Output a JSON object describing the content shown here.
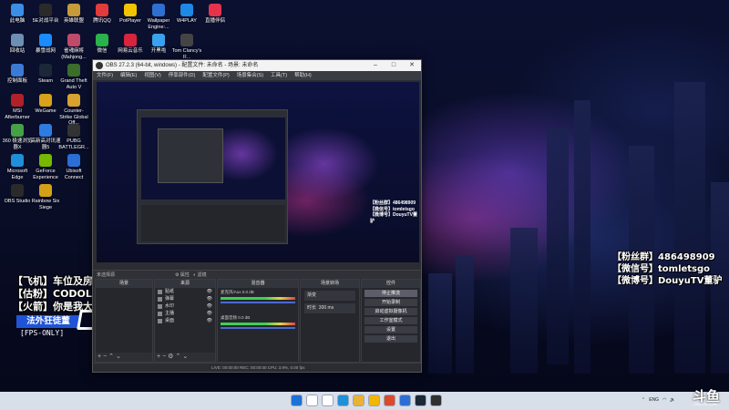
{
  "desktop": {
    "icons": [
      {
        "label": "此电脑",
        "color": "#3a8ee6"
      },
      {
        "label": "5E对战平台",
        "color": "#2a2a2a"
      },
      {
        "label": "英雄联盟",
        "color": "#c79a3a"
      },
      {
        "label": "腾讯QQ",
        "color": "#e23b3b"
      },
      {
        "label": "PotPlayer",
        "color": "#f2c400"
      },
      {
        "label": "Wallpaper Engine:...",
        "color": "#2f6fd0"
      },
      {
        "label": "W4PLAY",
        "color": "#1e88e5"
      },
      {
        "label": "直播伴侣",
        "color": "#e5334d"
      },
      {
        "label": "回收站",
        "color": "#6d8fb3"
      },
      {
        "label": "暴雪战网",
        "color": "#1a8cff"
      },
      {
        "label": "雀魂麻将 (Mahjong...",
        "color": "#c04a6a"
      },
      {
        "label": "微信",
        "color": "#2ab34a"
      },
      {
        "label": "网易云音乐",
        "color": "#d8243d"
      },
      {
        "label": "开黑啦",
        "color": "#3aa0f0"
      },
      {
        "label": "Tom Clancy's R...",
        "color": "#444444"
      },
      {
        "label": "控制面板",
        "color": "#3b7bd6"
      },
      {
        "label": "Steam",
        "color": "#1b2838"
      },
      {
        "label": "Grand Theft Auto V",
        "color": "#3a6e2a"
      },
      {
        "label": "MSI Afterburner",
        "color": "#b2202a"
      },
      {
        "label": "WeGame",
        "color": "#d9a21b"
      },
      {
        "label": "Counter-Strike Global Off...",
        "color": "#d8a230"
      },
      {
        "label": "360 极速浏览器X",
        "color": "#46a046"
      },
      {
        "label": "高新高对讯速 器5",
        "color": "#2f7ce0"
      },
      {
        "label": "PUBG BATTLEGR...",
        "color": "#333333"
      },
      {
        "label": "Microsoft Edge",
        "color": "#1f8fd9"
      },
      {
        "label": "GeForce Experience",
        "color": "#76b900"
      },
      {
        "label": "Ubisoft Connect",
        "color": "#2b6fd6"
      },
      {
        "label": "OBS Studio",
        "color": "#2a2a2a"
      },
      {
        "label": "Rainbow Six Siege",
        "color": "#d4a017"
      }
    ]
  },
  "overlay_left": {
    "line1": "【飞机】车位及房管",
    "line2": "【估粉】CODOL输狗",
    "line3": "【火箭】你是我大哥",
    "badge": "法外狂徒董",
    "fps": "[FPS-ONLY]"
  },
  "overlay_right": {
    "line1": "【粉丝群】486498909",
    "line2": "【微信号】tomletsgo",
    "line3": "【微博号】DouyuTV董驴"
  },
  "obs": {
    "title": "OBS 27.2.3 (64-bit, windows) - 配置文件: 未命名 - 场景: 未命名",
    "menu": [
      "文件(F)",
      "编辑(E)",
      "视图(V)",
      "停靠部件(D)",
      "配置文件(P)",
      "场景集合(S)",
      "工具(T)",
      "帮助(H)"
    ],
    "preview_text": [
      "【粉丝群】486498909",
      "【微信号】tomletsgo",
      "【微博号】DouyuTV董驴"
    ],
    "source_bar_label": "未选择源",
    "source_bar_props": "属性",
    "source_bar_filter": "滤镜",
    "docks": {
      "scenes": "场景",
      "sources": "来源",
      "mixer": "混音器",
      "transitions": "场景转场",
      "controls": "控件"
    },
    "sources": [
      "贴纸",
      "弹幕",
      "水印",
      "主播",
      "桌面"
    ],
    "mixer_tracks": [
      {
        "name": "麦克风/Aux",
        "level": "0.0 dB"
      },
      {
        "name": "桌面音频",
        "level": "0.0 dB"
      }
    ],
    "transition": "渐变",
    "duration_label": "时长",
    "duration_value": "300 ms",
    "controls": [
      "停止推流",
      "开始录制",
      "启动虚拟摄像机",
      "工作室模式",
      "设置",
      "退出"
    ],
    "status": "LIVE: 00:00:00   REC: 00:00:00   CPU: 3.9%, 0.00 fps"
  },
  "taskbar": {
    "icons": [
      {
        "name": "windows-start-icon",
        "color": "#1d72d8"
      },
      {
        "name": "search-icon",
        "color": "#ffffff"
      },
      {
        "name": "task-view-icon",
        "color": "#ffffff"
      },
      {
        "name": "edge-icon",
        "color": "#1f8fd9"
      },
      {
        "name": "chrome-icon",
        "color": "#e9b236"
      },
      {
        "name": "file-explorer-icon",
        "color": "#f2b705"
      },
      {
        "name": "office-icon",
        "color": "#d94b2b"
      },
      {
        "name": "store-icon",
        "color": "#2b6fd6"
      },
      {
        "name": "steam-icon",
        "color": "#1b2838"
      },
      {
        "name": "obs-icon",
        "color": "#303030"
      }
    ],
    "tray_lang": "ENG",
    "time": "",
    "date": ""
  },
  "watermark": {
    "main": "斗鱼",
    "sub": "DOUYU.COM"
  }
}
